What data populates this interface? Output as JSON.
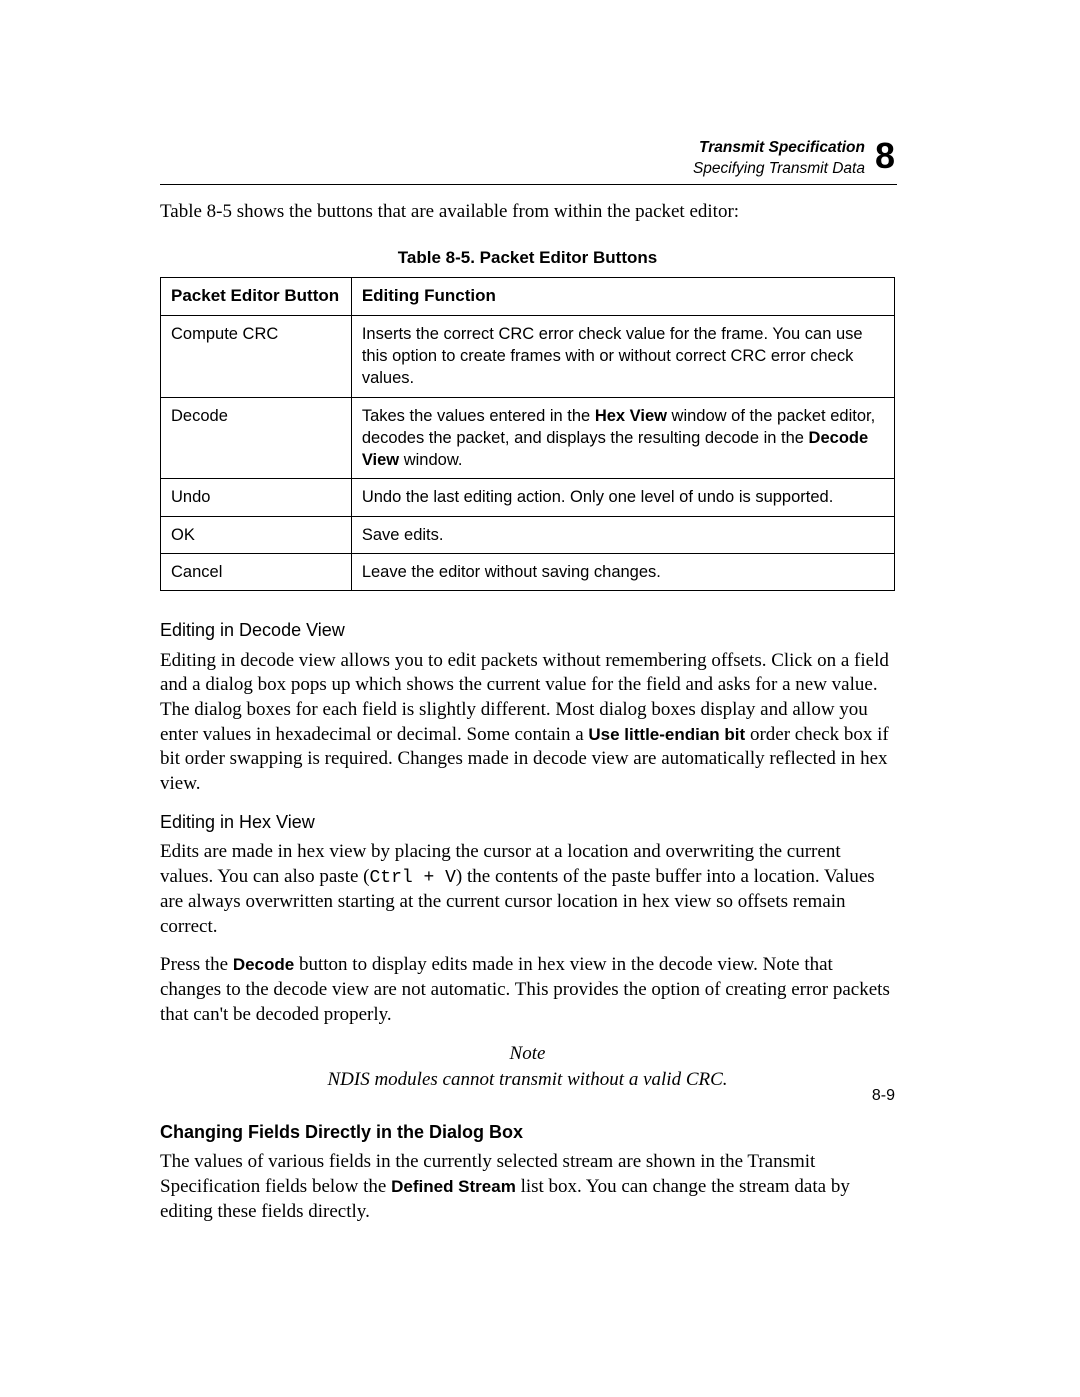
{
  "header": {
    "title": "Transmit Specification",
    "subtitle": "Specifying Transmit Data",
    "chapter_number": "8"
  },
  "intro_before": "Table 8-5 shows the buttons that are available from within the packet editor:",
  "table": {
    "caption": "Table 8-5. Packet Editor Buttons",
    "head_col1": "Packet Editor Button",
    "head_col2": "Editing Function",
    "rows": [
      {
        "button": "Compute CRC",
        "desc": "Inserts the correct CRC error check value for the frame. You can use this option to create frames with or without correct CRC error check values."
      },
      {
        "button": "Decode",
        "desc_pre": "Takes the values entered in the ",
        "desc_b1": "Hex View",
        "desc_mid": " window of the packet editor, decodes the packet, and displays the resulting decode in the ",
        "desc_b2": "Decode View",
        "desc_post": " window."
      },
      {
        "button": "Undo",
        "desc": "Undo the last editing action. Only one level of undo is supported."
      },
      {
        "button": "OK",
        "desc": "Save edits."
      },
      {
        "button": "Cancel",
        "desc": "Leave the editor without saving changes."
      }
    ]
  },
  "sec1": {
    "heading": "Editing in Decode View",
    "p_pre": "Editing in decode view allows you to edit packets without remembering offsets. Click on a field and a dialog box pops up which shows the current value for the field and asks for a new value. The dialog boxes for each field is slightly different. Most dialog boxes display and allow you enter values in hexadecimal or decimal. Some contain a ",
    "p_bold": "Use little-endian bit",
    "p_post": " order check box if bit order swapping is required. Changes made in decode view are automatically reflected in hex view."
  },
  "sec2": {
    "heading": "Editing in Hex View",
    "p1_pre": "Edits are made in hex view by placing the cursor at a location and overwriting the current values. You can also paste (",
    "p1_mono": "Ctrl + V",
    "p1_post": ") the contents of the paste buffer into a location. Values are always overwritten starting at the current cursor location in hex view so offsets remain correct.",
    "p2_pre": "Press the ",
    "p2_bold": "Decode",
    "p2_post": " button to display edits made in hex view in the decode view. Note that changes to the decode view are not automatic. This provides the option of creating error packets that can't be decoded properly."
  },
  "note_label": "Note",
  "note_text": "NDIS modules cannot transmit without a valid CRC.",
  "sec3": {
    "heading": "Changing Fields Directly in the Dialog Box",
    "p_pre": "The values of various fields in the currently selected stream are shown in the Transmit Specification fields below the ",
    "p_bold": "Defined Stream",
    "p_post": " list box. You can change the stream data by editing these fields directly."
  },
  "page_number": "8-9"
}
